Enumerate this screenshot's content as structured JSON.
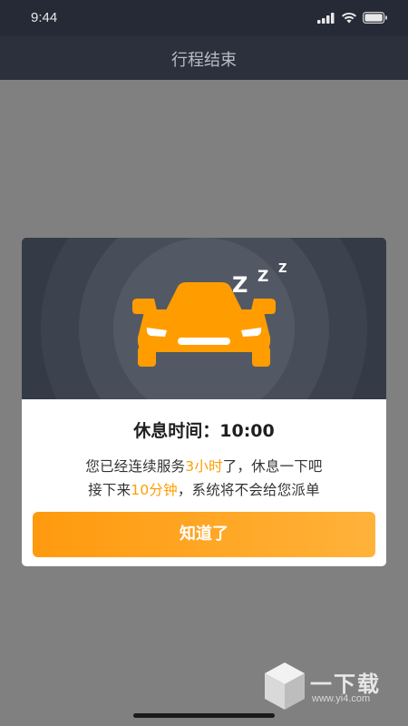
{
  "status_bar": {
    "time": "9:44"
  },
  "nav": {
    "title": "行程结束"
  },
  "modal": {
    "rest_label": "休息时间：",
    "rest_value": "10:00",
    "message_line1_prefix": "您已经连续服务",
    "message_line1_highlight": "3小时",
    "message_line1_suffix": "了，休息一下吧",
    "message_line2_prefix": "接下来",
    "message_line2_highlight": "10分钟",
    "message_line2_suffix": "，系统将不会给您派单",
    "confirm_label": "知道了",
    "sleep_letters": [
      "Z",
      "Z",
      "Z"
    ]
  },
  "watermark": {
    "brand": "一下载",
    "url": "www.yi4.com"
  },
  "colors": {
    "accent": "#ff9d00",
    "button_gradient_start": "#ff9a0e",
    "button_gradient_end": "#ffb23a",
    "overlay": "#808080",
    "hero_bg": "#2e343f"
  },
  "icons": [
    "signal-icon",
    "wifi-icon",
    "battery-icon",
    "car-icon",
    "cube-logo-icon"
  ]
}
